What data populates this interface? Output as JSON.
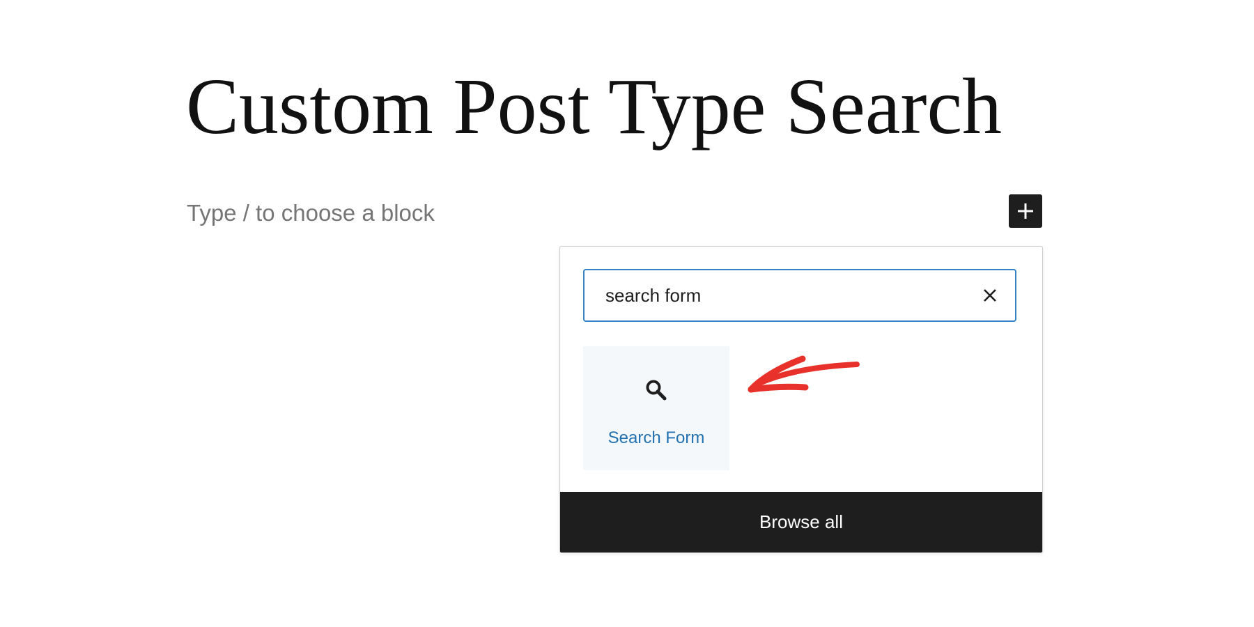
{
  "editor": {
    "title": "Custom Post Type Search",
    "block_placeholder": "Type / to choose a block",
    "add_block_icon": "plus-icon"
  },
  "inserter": {
    "search_value": "search form",
    "clear_icon": "close-icon",
    "results": [
      {
        "label": "Search Form",
        "icon": "search-icon"
      }
    ],
    "browse_all_label": "Browse all"
  },
  "colors": {
    "focus_border": "#3582c4",
    "result_label": "#2271b1",
    "result_background": "#f4f8fb",
    "browse_all_background": "#1e1e1e",
    "annotation_arrow": "#e8312a"
  }
}
